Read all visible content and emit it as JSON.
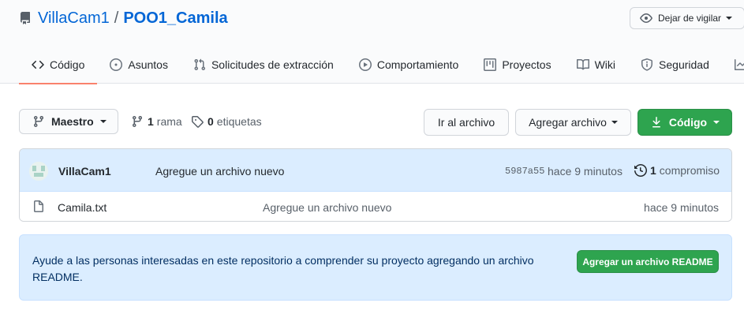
{
  "repo": {
    "owner": "VillaCam1",
    "separator": "/",
    "name": "POO1_Camila"
  },
  "watch": {
    "label": "Dejar de vigilar"
  },
  "tabs": [
    {
      "label": "Código",
      "icon": "code-icon",
      "active": true
    },
    {
      "label": "Asuntos",
      "icon": "issue-opened-icon",
      "active": false
    },
    {
      "label": "Solicitudes de extracción",
      "icon": "pull-request-icon",
      "active": false
    },
    {
      "label": "Comportamiento",
      "icon": "play-icon",
      "active": false
    },
    {
      "label": "Proyectos",
      "icon": "project-icon",
      "active": false
    },
    {
      "label": "Wiki",
      "icon": "book-icon",
      "active": false
    },
    {
      "label": "Seguridad",
      "icon": "shield-icon",
      "active": false
    }
  ],
  "toolbar": {
    "branch_label": "Maestro",
    "branch_count": "1",
    "branch_word": "rama",
    "tag_count": "0",
    "tag_word": "etiquetas",
    "go_to_file": "Ir al archivo",
    "add_file": "Agregar archivo",
    "code": "Código"
  },
  "commit": {
    "author": "VillaCam1",
    "message": "Agregue un archivo nuevo",
    "sha": "5987a55",
    "age": "hace 9 minutos",
    "count": "1",
    "count_word": "compromiso"
  },
  "files": [
    {
      "name": "Camila.txt",
      "message": "Agregue un archivo nuevo",
      "age": "hace 9 minutos",
      "icon": "file-icon"
    }
  ],
  "readme": {
    "text": "Ayude a las personas interesadas en este repositorio a comprender su proyecto agregando un archivo README.",
    "button": "Agregar un archivo README"
  },
  "colors": {
    "link": "#0366d6",
    "active_tab_underline": "#f9826c",
    "primary_button": "#2ea44f",
    "info_background": "#dbedff"
  }
}
